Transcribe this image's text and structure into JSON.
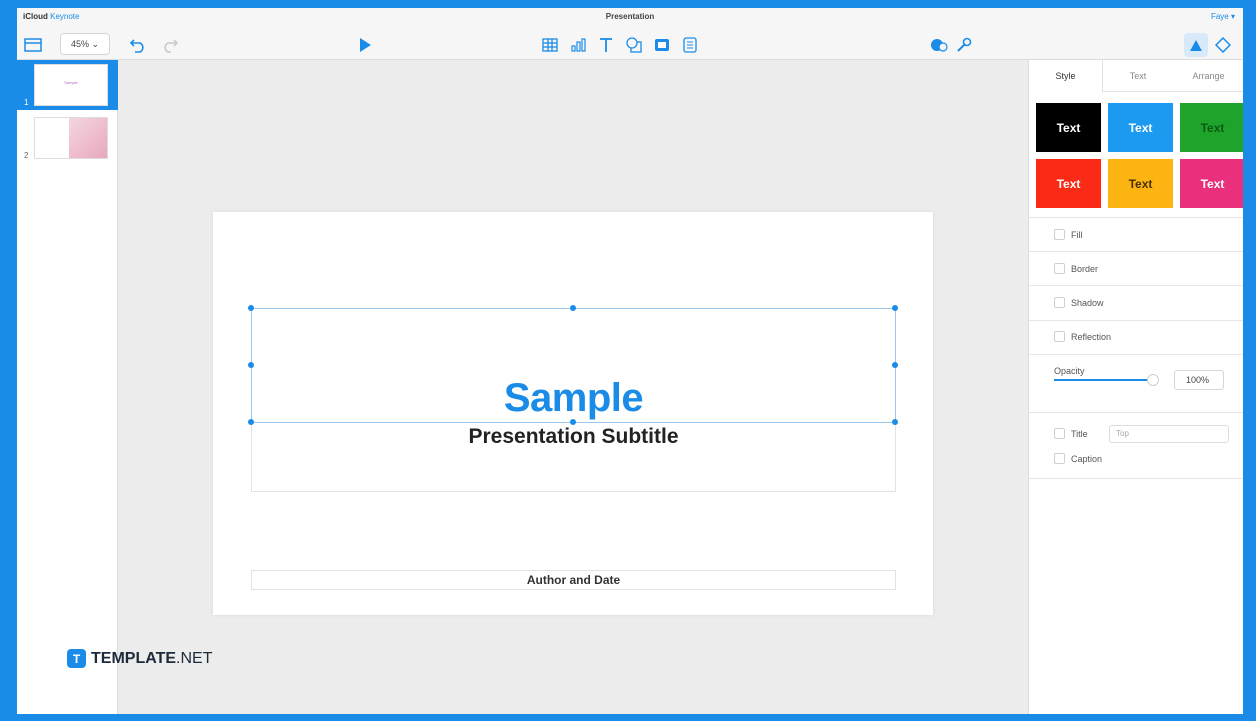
{
  "topbar": {
    "brand": "iCloud",
    "app": "Keynote",
    "doc_title": "Presentation",
    "user": "Faye ▾"
  },
  "toolbar": {
    "zoom": "45% ⌄"
  },
  "slides": [
    {
      "number": "1",
      "label": "Sample"
    },
    {
      "number": "2",
      "label": ""
    }
  ],
  "slide": {
    "title": "Sample",
    "subtitle": "Presentation Subtitle",
    "author": "Author and Date"
  },
  "watermark": {
    "badge": "T",
    "name": "TEMPLATE",
    "suffix": ".NET"
  },
  "inspector": {
    "tabs": [
      "Style",
      "Text",
      "Arrange"
    ],
    "swatches": [
      {
        "label": "Text",
        "color": "#000000"
      },
      {
        "label": "Text",
        "color": "#1c9af0"
      },
      {
        "label": "Text",
        "color": "#1fa42b"
      },
      {
        "label": "Text",
        "color": "#fb2a16"
      },
      {
        "label": "Text",
        "color": "#fcb413"
      },
      {
        "label": "Text",
        "color": "#ea2f7c"
      }
    ],
    "options": {
      "fill": "Fill",
      "border": "Border",
      "shadow": "Shadow",
      "reflection": "Reflection"
    },
    "opacity": {
      "label": "Opacity",
      "value": "100%",
      "level": 1.0
    },
    "title_label": "Title",
    "title_position": "Top",
    "caption_label": "Caption"
  }
}
